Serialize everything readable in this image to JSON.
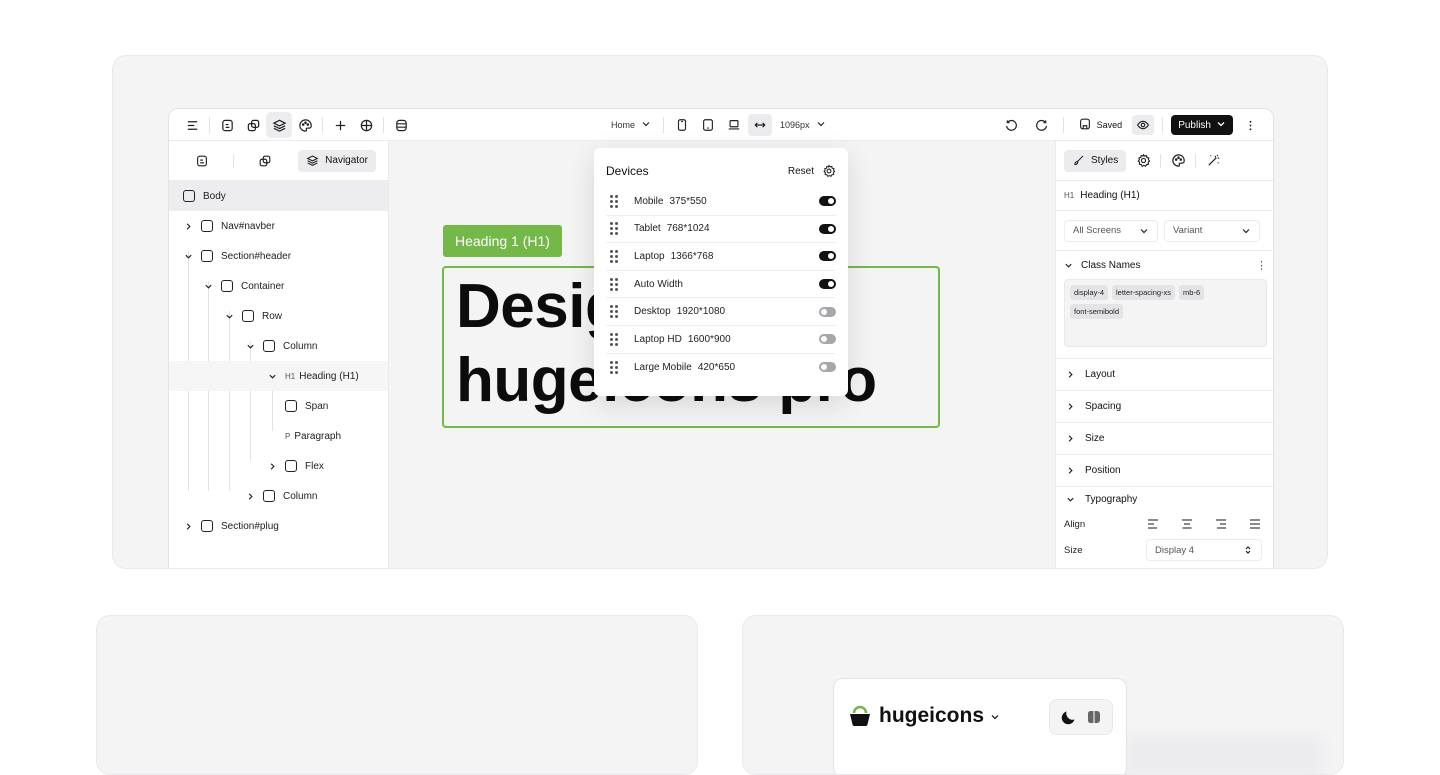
{
  "toolbar": {
    "page_select": "Home",
    "width_select": "1096px",
    "saved_label": "Saved",
    "publish_label": "Publish"
  },
  "navigator": {
    "tab_label": "Navigator",
    "items": [
      {
        "label": "Body",
        "depth": 0
      },
      {
        "label": "Nav#navber",
        "depth": 0
      },
      {
        "label": "Section#header",
        "depth": 0
      },
      {
        "label": "Container",
        "depth": 1
      },
      {
        "label": "Row",
        "depth": 2
      },
      {
        "label": "Column",
        "depth": 3
      },
      {
        "tag": "H1",
        "label": "Heading (H1)",
        "depth": 4
      },
      {
        "label": "Span",
        "depth": 5
      },
      {
        "tag": "P",
        "label": "Paragraph",
        "depth": 5
      },
      {
        "label": "Flex",
        "depth": 4
      },
      {
        "label": "Column",
        "depth": 3
      },
      {
        "label": "Section#plug",
        "depth": 0
      }
    ]
  },
  "canvas": {
    "badge_label": "Heading 1 (H1)",
    "heading_line1": "Design",
    "heading_line2": "hugeicons pro"
  },
  "devices": {
    "title": "Devices",
    "reset_label": "Reset",
    "items": [
      {
        "name": "Mobile",
        "size": "375*550",
        "enabled": true
      },
      {
        "name": "Tablet",
        "size": "768*1024",
        "enabled": true
      },
      {
        "name": "Laptop",
        "size": "1366*768",
        "enabled": true
      },
      {
        "name": "Auto Width",
        "size": "",
        "enabled": true
      },
      {
        "name": "Desktop",
        "size": "1920*1080",
        "enabled": false
      },
      {
        "name": "Laptop HD",
        "size": "1600*900",
        "enabled": false
      },
      {
        "name": "Large Mobile",
        "size": "420*650",
        "enabled": false
      }
    ]
  },
  "styles_panel": {
    "tab_label": "Styles",
    "element_tag": "H1",
    "element_label": "Heading (H1)",
    "screens_select": "All Screens",
    "variant_select": "Variant",
    "class_names_label": "Class Names",
    "class_names": [
      "display-4",
      "letter-spacing-xs",
      "mb-6",
      "font-semibold"
    ],
    "sections": [
      "Layout",
      "Spacing",
      "Size",
      "Position"
    ],
    "typography_label": "Typography",
    "align_label": "Align",
    "size_label": "Size",
    "size_value": "Display 4"
  },
  "brand": {
    "name": "hugeicons"
  },
  "colors": {
    "accent_green": "#74b84a",
    "panel_bg": "#f4f4f5",
    "dark": "#111111"
  }
}
